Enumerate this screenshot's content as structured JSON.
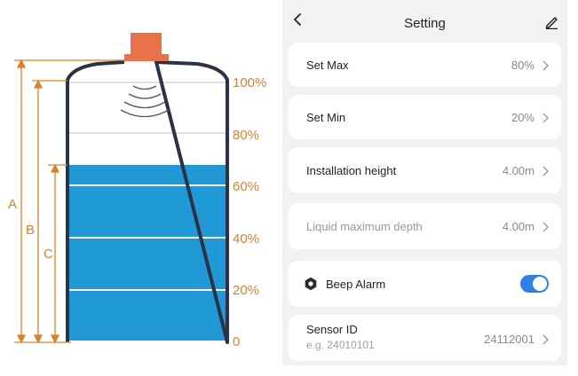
{
  "diagram": {
    "levels": [
      "100%",
      "80%",
      "60%",
      "40%",
      "20%",
      "0"
    ],
    "dimensions": [
      "A",
      "B",
      "C"
    ],
    "colors": {
      "accent": "#d9822b",
      "liquid": "#2198d6",
      "tank": "#2c3245",
      "sensor": "#e8734a"
    }
  },
  "header": {
    "title": "Setting",
    "back_icon": "chevron-left-icon",
    "edit_icon": "edit-icon"
  },
  "settings": {
    "set_max": {
      "label": "Set Max",
      "value": "80%"
    },
    "set_min": {
      "label": "Set Min",
      "value": "20%"
    },
    "installation_height": {
      "label": "Installation height",
      "value": "4.00m"
    },
    "liquid_max_depth": {
      "label": "Liquid maximum depth",
      "value": "4.00m"
    },
    "beep_alarm": {
      "label": "Beep Alarm",
      "enabled": true,
      "icon": "hexagon-nut-icon"
    },
    "sensor_id": {
      "label": "Sensor ID",
      "placeholder": "e.g. 24010101",
      "value": "24112001"
    }
  },
  "colors": {
    "panel_bg": "#f2f2f4",
    "toggle_on": "#2f7fe8"
  }
}
